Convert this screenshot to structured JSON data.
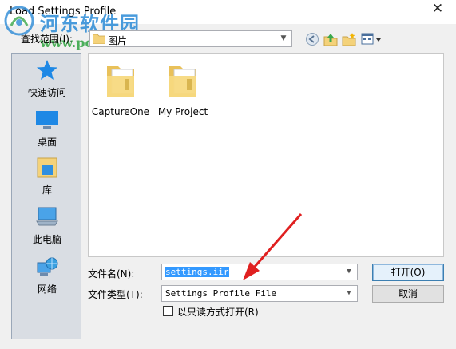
{
  "dialog": {
    "title": "Load Settings Profile",
    "close_glyph": "✕"
  },
  "watermark": {
    "title": "河东软件园",
    "url": "www.pc0359.cn"
  },
  "lookin": {
    "label": "查找范围(I):",
    "value": "图片"
  },
  "toolbar": {
    "icons": [
      "back-icon",
      "up-folder-icon",
      "new-folder-icon",
      "view-menu-icon"
    ]
  },
  "places": [
    {
      "label": "快速访问",
      "icon": "star-icon"
    },
    {
      "label": "桌面",
      "icon": "desktop-icon"
    },
    {
      "label": "库",
      "icon": "library-icon"
    },
    {
      "label": "此电脑",
      "icon": "computer-icon"
    },
    {
      "label": "网络",
      "icon": "network-icon"
    }
  ],
  "files": [
    {
      "label": "CaptureOne",
      "icon": "folder-icon"
    },
    {
      "label": "My Project",
      "icon": "folder-icon"
    }
  ],
  "filename": {
    "label": "文件名(N):",
    "value": "settings.iir"
  },
  "filetype": {
    "label": "文件类型(T):",
    "value": "Settings Profile File"
  },
  "readonly": {
    "label": "以只读方式打开(R)",
    "checked": false
  },
  "buttons": {
    "open": "打开(O)",
    "cancel": "取消"
  },
  "colors": {
    "selection": "#3399ff",
    "annotation_arrow": "#e02020",
    "watermark_blue": "#2a8ad6",
    "watermark_green": "#3aa84a"
  }
}
